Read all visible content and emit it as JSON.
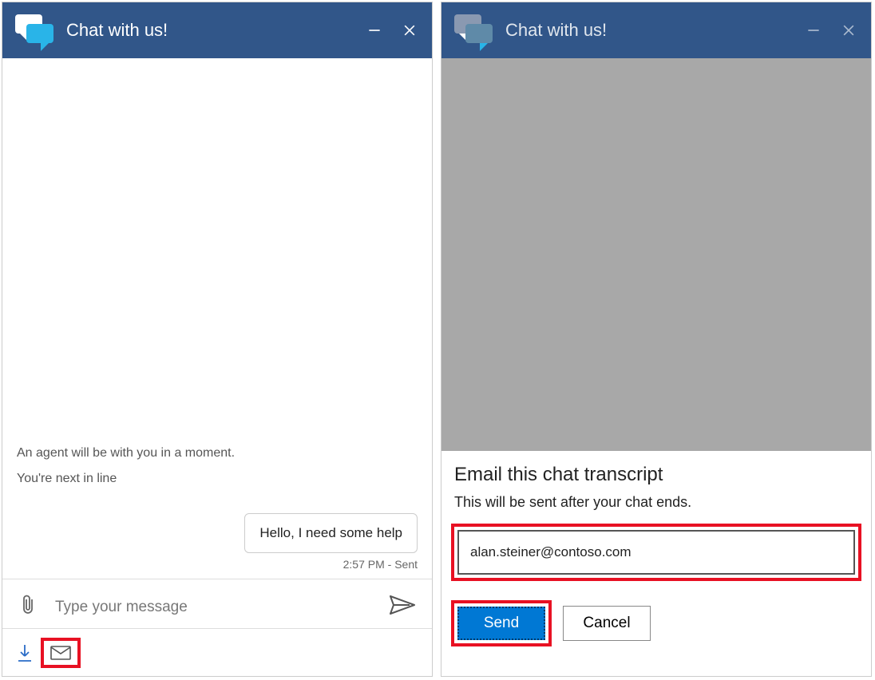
{
  "header": {
    "title": "Chat with us!"
  },
  "chat": {
    "system_messages": [
      "An agent will be with you in a moment.",
      "You're next in line"
    ],
    "outgoing_message": "Hello, I need some help",
    "outgoing_meta": "2:57 PM - Sent",
    "input_placeholder": "Type your message"
  },
  "email_sheet": {
    "title": "Email this chat transcript",
    "subtitle": "This will be sent after your chat ends.",
    "email_value": "alan.steiner@contoso.com",
    "send_label": "Send",
    "cancel_label": "Cancel"
  }
}
